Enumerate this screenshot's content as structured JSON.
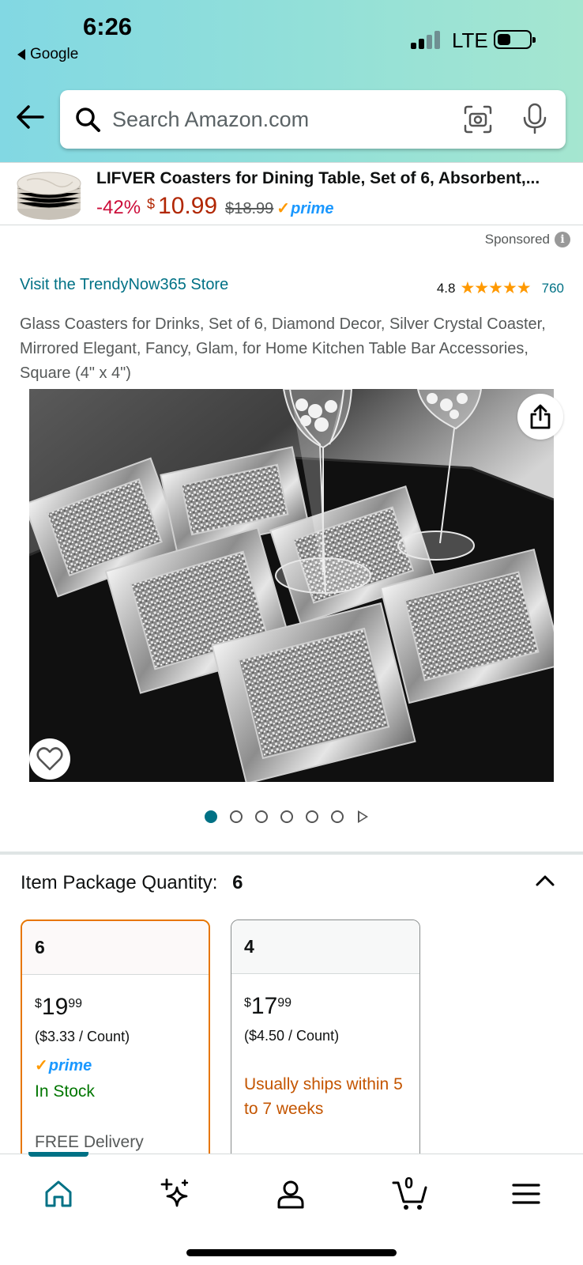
{
  "status_bar": {
    "time": "6:26",
    "back_app": "Google",
    "network": "LTE"
  },
  "search": {
    "placeholder": "Search Amazon.com"
  },
  "sponsored_banner": {
    "title": "LIFVER Coasters for Dining Table, Set of 6, Absorbent,...",
    "discount": "-42%",
    "currency": "$",
    "price": "10.99",
    "was_price": "$18.99",
    "prime": "prime"
  },
  "sponsored_label": "Sponsored",
  "product": {
    "store_link": "Visit the TrendyNow365 Store",
    "rating": "4.8",
    "stars": "★★★★★",
    "rating_count": "760",
    "title": "Glass Coasters for Drinks, Set of 6, Diamond Decor, Silver Crystal Coaster, Mirrored Elegant, Fancy, Glam, for Home Kitchen Table Bar Accessories, Square (4\" x 4\")",
    "image_count": 6,
    "active_image": 1
  },
  "package_quantity": {
    "label": "Item Package Quantity:",
    "value": "6"
  },
  "options": [
    {
      "qty": "6",
      "price_symbol": "$",
      "price_whole": "19",
      "price_fraction": "99",
      "unit_price": "($3.33 / Count)",
      "prime": "prime",
      "availability": "In Stock",
      "delivery": "FREE Delivery",
      "selected": true
    },
    {
      "qty": "4",
      "price_symbol": "$",
      "price_whole": "17",
      "price_fraction": "99",
      "unit_price": "($4.50 / Count)",
      "availability": "Usually ships within 5 to 7 weeks",
      "selected": false
    }
  ],
  "bottom_nav": {
    "cart_count": "0",
    "items": [
      "home-icon",
      "ai-sparkle-icon",
      "account-icon",
      "cart-icon",
      "menu-icon"
    ]
  },
  "colors": {
    "link": "#007185",
    "price": "#b12704",
    "discount": "#cc0c39",
    "in_stock": "#007600",
    "ships_later": "#c45500",
    "selected_border": "#e77600",
    "prime": "#1a98ff",
    "star": "#ff9900"
  }
}
